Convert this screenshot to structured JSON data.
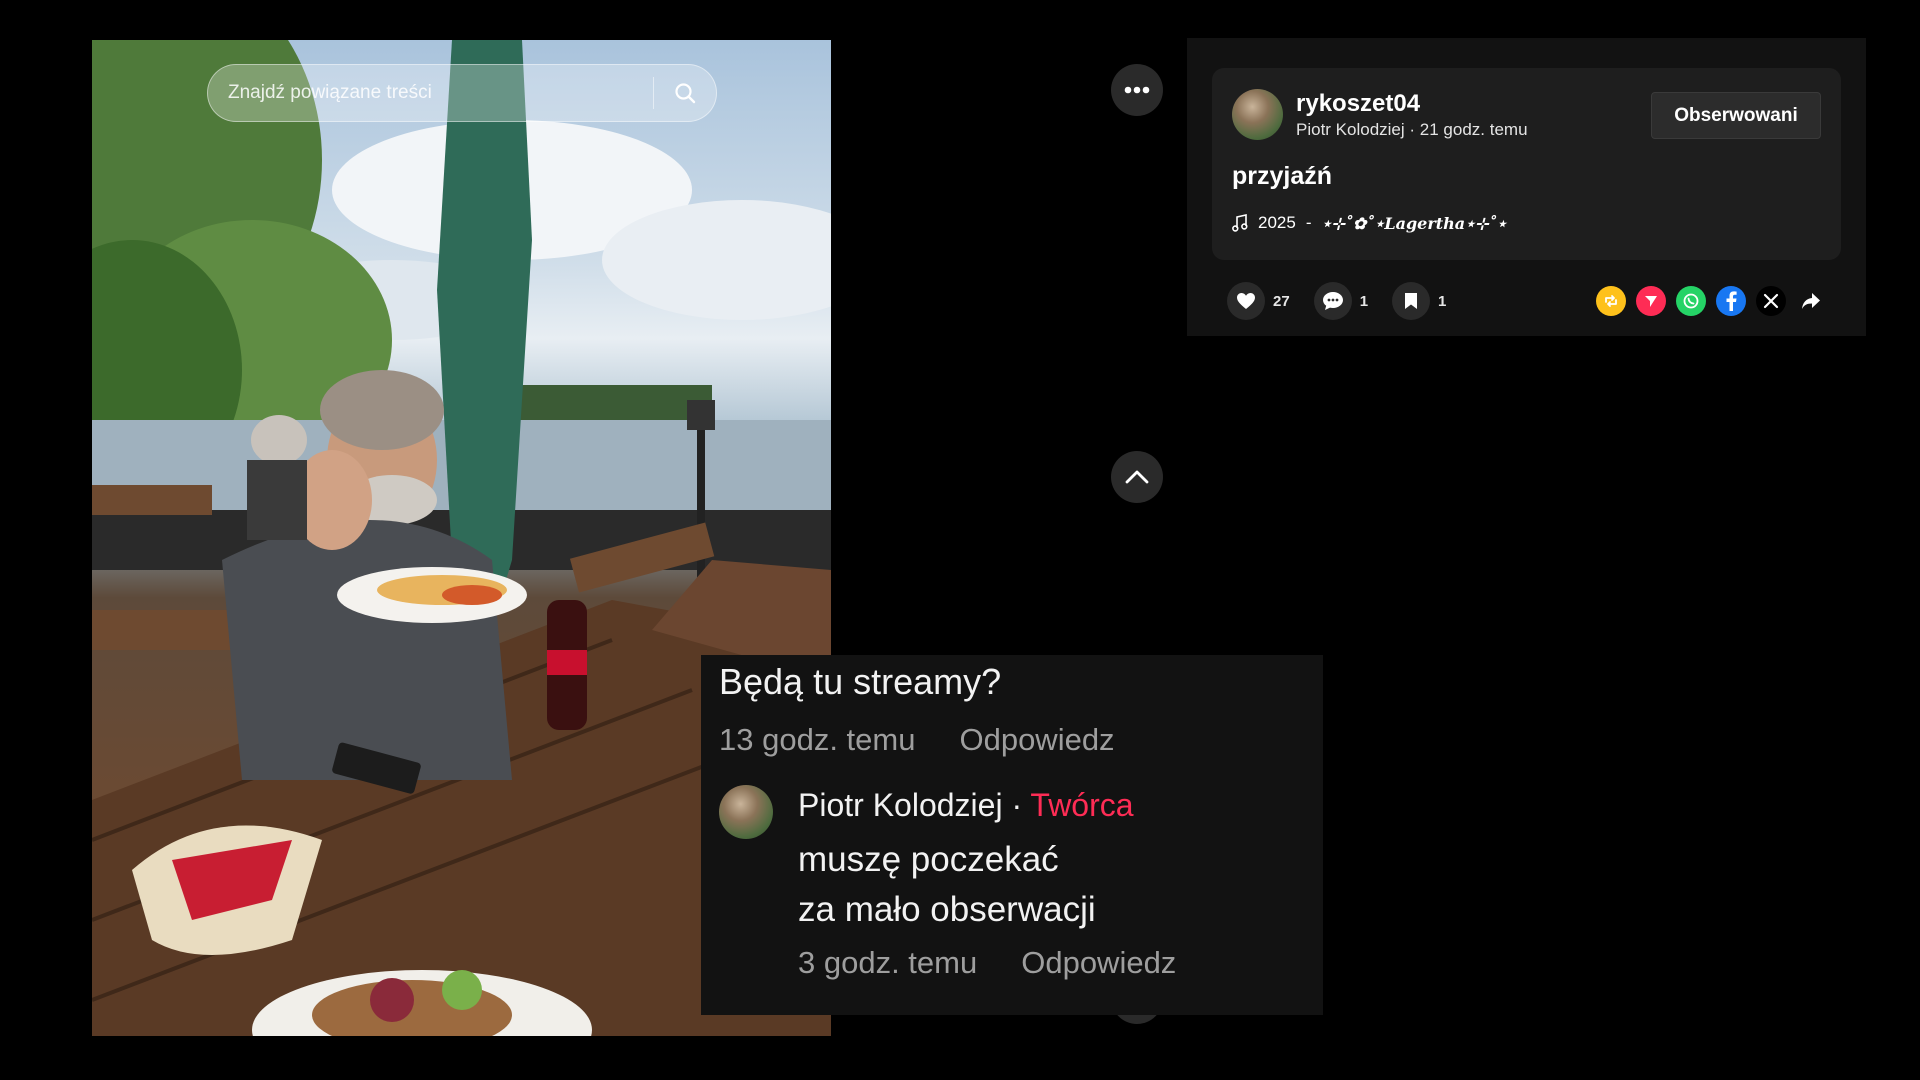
{
  "search": {
    "placeholder": "Znajdź powiązane treści"
  },
  "post": {
    "username": "rykoszet04",
    "display_name": "Piotr Kolodziej",
    "time_ago": "21 godz. temu",
    "follow_label": "Obserwowani",
    "description": "przyjaźń",
    "music_year": "2025",
    "music_sound": "⋆⊹˚✿˚⋆Lagertha⋆⊹˚⋆"
  },
  "stats": {
    "likes": "27",
    "comments": "1",
    "saves": "1"
  },
  "share_icons": [
    "repost-icon",
    "send-icon",
    "whatsapp-icon",
    "facebook-icon",
    "x-icon",
    "share-arrow-icon"
  ],
  "comments": {
    "question_text": "Będą tu streamy?",
    "question_time": "13 godz. temu",
    "reply_label": "Odpowiedz",
    "reply": {
      "author": "Piotr Kolodziej",
      "separator": "·",
      "badge": "Twórca",
      "line1": "muszę poczekać",
      "line2": "za mało obserwacji",
      "time": "3 godz. temu"
    }
  },
  "colors": {
    "accent_red": "#fe2c55",
    "panel_bg": "#121212",
    "card_bg": "#1e1e1e"
  }
}
